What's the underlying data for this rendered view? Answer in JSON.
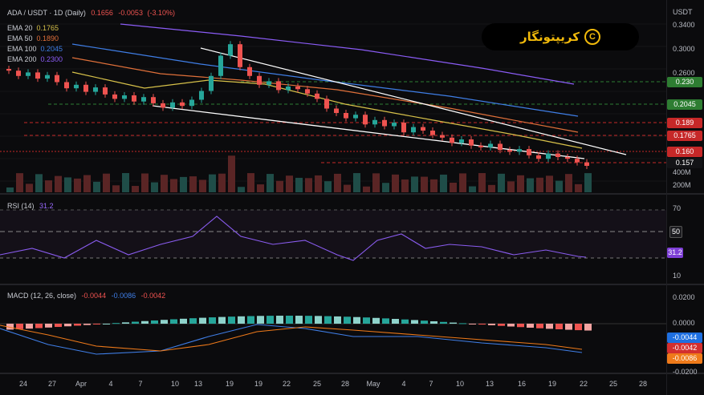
{
  "header": {
    "symbol": "ADA / USDT · 1D (Daily)",
    "last": "0.1656",
    "change": "-0.0053",
    "change_pct": "(-3.10%)"
  },
  "emas": [
    {
      "label": "EMA 20",
      "value": "0.1765",
      "color": "#d8c24a"
    },
    {
      "label": "EMA 50",
      "value": "0.1890",
      "color": "#e0703a"
    },
    {
      "label": "EMA 100",
      "value": "0.2045",
      "color": "#3f7ee6"
    },
    {
      "label": "EMA 200",
      "value": "0.2300",
      "color": "#8b5cf6"
    }
  ],
  "logo": {
    "text": "کریپتونگار",
    "mark": "C"
  },
  "price_axis": {
    "currency": "USDT",
    "ticks": [
      "0.3400",
      "0.3000",
      "0.2600",
      "0.2300",
      "0.2045",
      "0.1890",
      "0.1765",
      "0.160",
      "0.157",
      "400M",
      "200M"
    ],
    "tags": [
      {
        "text": "0.230",
        "color": "#2e7d32"
      },
      {
        "text": "0.2045",
        "color": "#2e7d32"
      },
      {
        "text": "0.189",
        "color": "#c62828"
      },
      {
        "text": "0.1765",
        "color": "#c62828"
      },
      {
        "text": "0.160",
        "color": "#c62828"
      },
      {
        "text": "0.157",
        "color": "#131316"
      }
    ]
  },
  "rsi": {
    "label": "RSI (14)",
    "value": "31.2",
    "ticks": [
      "70",
      "50",
      "30",
      "10"
    ],
    "tag_50": "50",
    "tag_value": "31.2"
  },
  "macd": {
    "label": "MACD (12, 26, close)",
    "hist": "-0.0044",
    "macd": "-0.0086",
    "signal": "-0.0042",
    "ticks": [
      "0.0200",
      "0.0000",
      "-0.0200"
    ],
    "tags": [
      {
        "text": "-0.0044",
        "color": "#1e6fe0"
      },
      {
        "text": "-0.0042",
        "color": "#d32f2f"
      },
      {
        "text": "-0.0086",
        "color": "#ef7a1a"
      }
    ]
  },
  "time_axis": [
    "24",
    "27",
    "Apr",
    "4",
    "7",
    "10",
    "13",
    "19",
    "19",
    "22",
    "25",
    "28",
    "May",
    "4",
    "7",
    "10",
    "13",
    "16",
    "19",
    "22",
    "25",
    "28"
  ],
  "colors": {
    "up": "#26a69a",
    "down": "#ef5350",
    "bg": "#0b0b0d"
  }
}
